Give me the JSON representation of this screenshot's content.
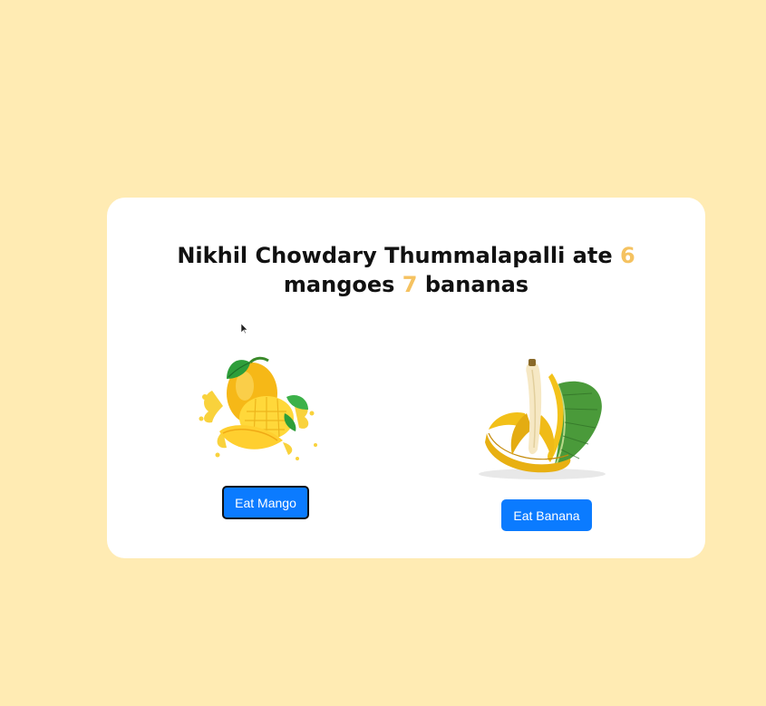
{
  "heading": {
    "name": "Nikhil Chowdary Thummalapalli",
    "ate_text": "ate",
    "mango_count": "6",
    "mangoes_text": "mangoes",
    "banana_count": "7",
    "bananas_text": "bananas"
  },
  "mango": {
    "image_icon": "mango-illustration",
    "button_label": "Eat Mango"
  },
  "banana": {
    "image_icon": "banana-illustration",
    "button_label": "Eat Banana"
  },
  "colors": {
    "page_background": "#ffebb3",
    "card_background": "#ffffff",
    "count_highlight": "#f5c260",
    "button_background": "#0b7bff"
  }
}
